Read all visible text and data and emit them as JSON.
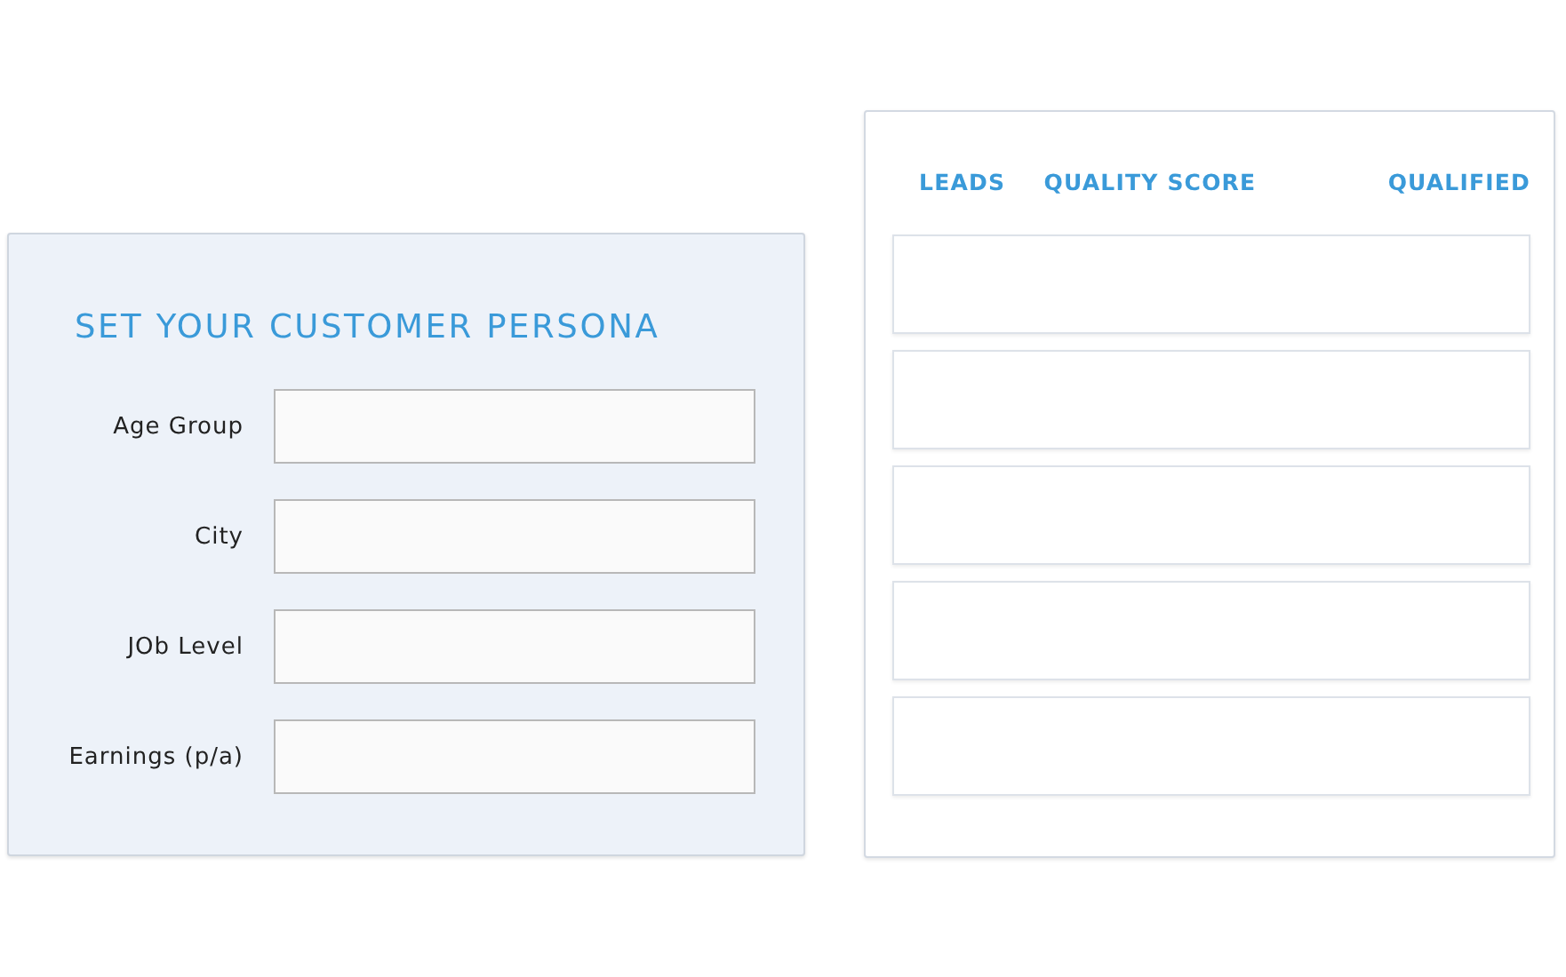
{
  "persona_form": {
    "title": "SET YOUR CUSTOMER PERSONA",
    "fields": [
      {
        "label": "Age Group"
      },
      {
        "label": "City"
      },
      {
        "label": "JOb Level"
      },
      {
        "label": "Earnings (p/a)"
      }
    ]
  },
  "leads_table": {
    "columns": [
      "LEADS",
      "QUALITY SCORE",
      "QUALIFIED"
    ]
  }
}
